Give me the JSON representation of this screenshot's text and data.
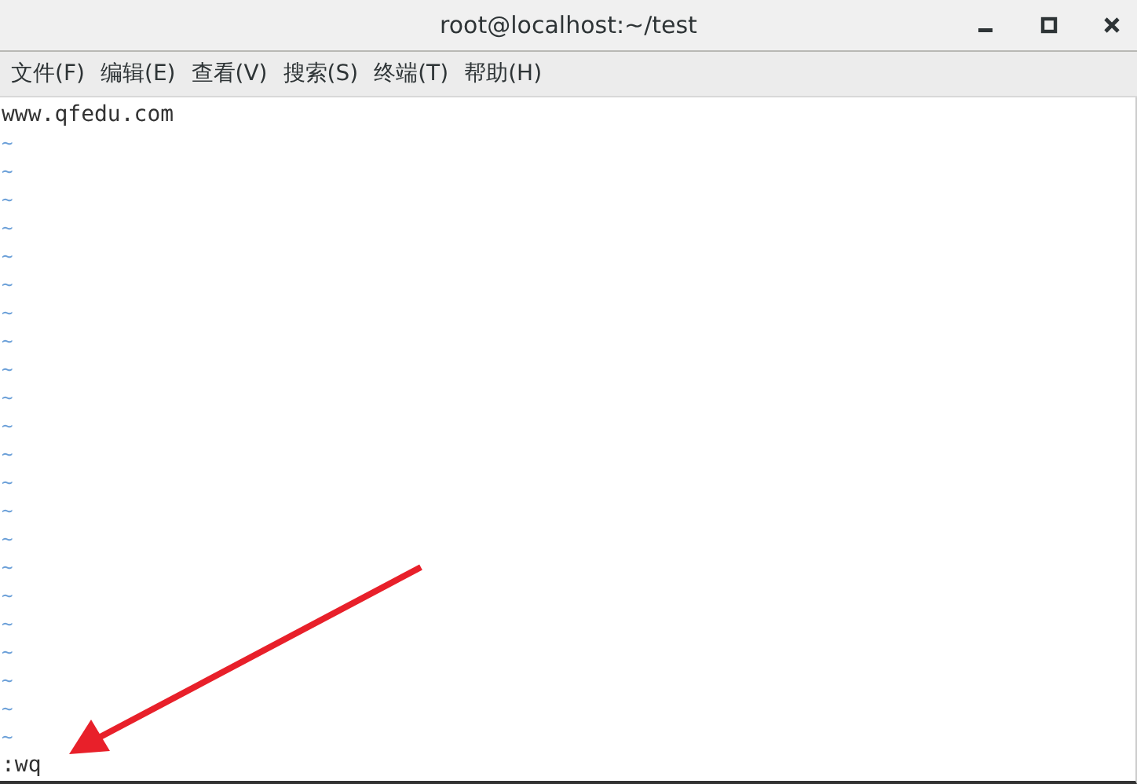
{
  "window": {
    "title": "root@localhost:~/test"
  },
  "menu": [
    {
      "label": "文件(F)"
    },
    {
      "label": "编辑(E)"
    },
    {
      "label": "查看(V)"
    },
    {
      "label": "搜索(S)"
    },
    {
      "label": "终端(T)"
    },
    {
      "label": "帮助(H)"
    }
  ],
  "editor": {
    "lines": [
      "www.qfedu.com"
    ],
    "empty_markers": [
      "~",
      "~",
      "~",
      "~",
      "~",
      "~",
      "~",
      "~",
      "~",
      "~",
      "~",
      "~",
      "~",
      "~",
      "~",
      "~",
      "~",
      "~",
      "~",
      "~",
      "~",
      "~"
    ],
    "command_line": ":wq"
  }
}
